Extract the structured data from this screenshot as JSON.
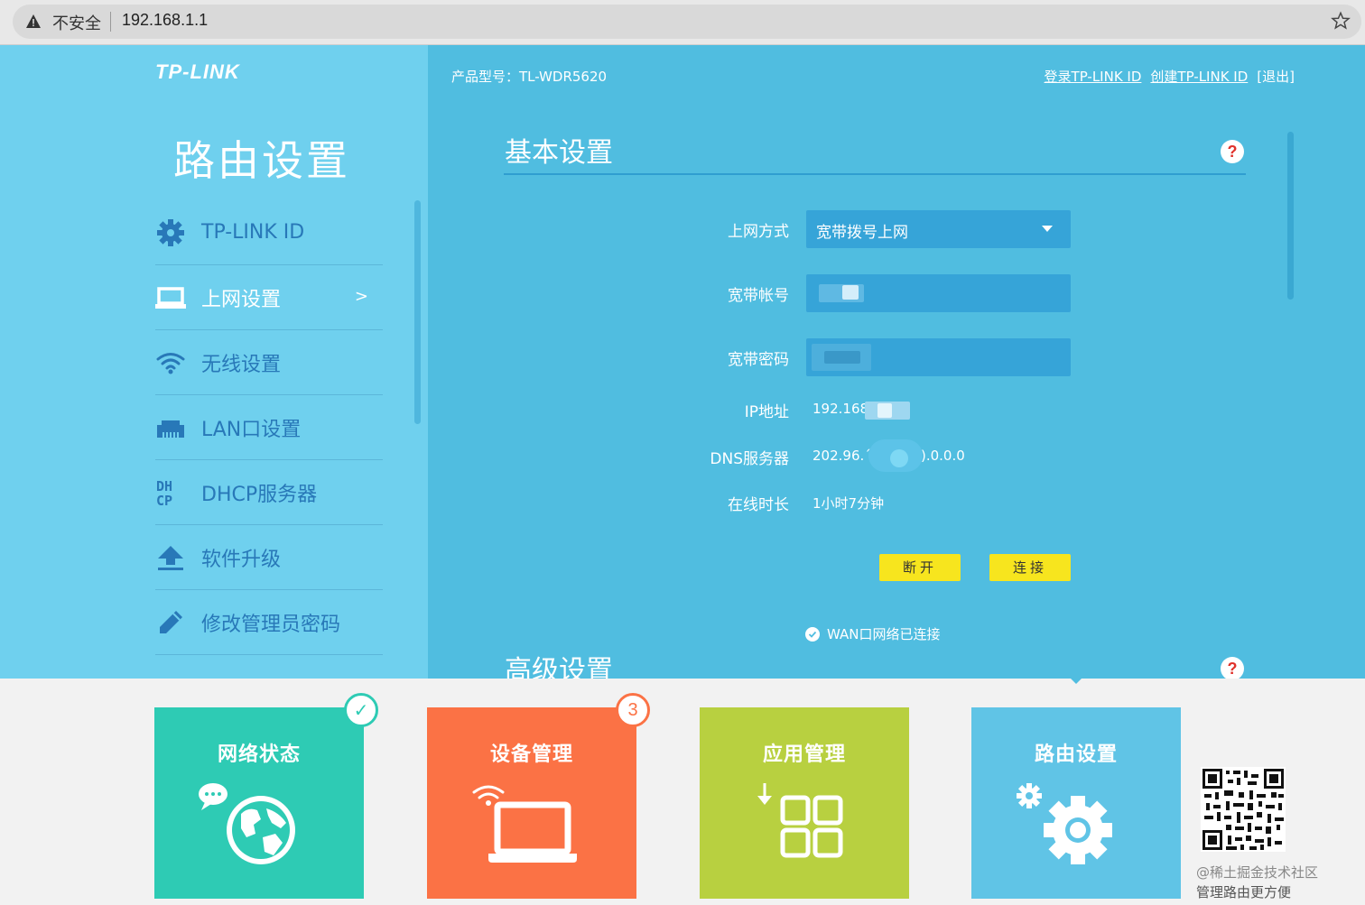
{
  "browser": {
    "security_label": "不安全",
    "url": "192.168.1.1"
  },
  "brand": {
    "logo_text": "TP-LINK"
  },
  "sidebar": {
    "title": "路由设置",
    "items": [
      {
        "label": "TP-LINK ID",
        "icon": "gear-icon",
        "active": false
      },
      {
        "label": "上网设置",
        "icon": "laptop-icon",
        "active": true,
        "arrow": ">"
      },
      {
        "label": "无线设置",
        "icon": "wifi-icon",
        "active": false
      },
      {
        "label": "LAN口设置",
        "icon": "lan-port-icon",
        "active": false
      },
      {
        "label": "DHCP服务器",
        "icon": "dhcp-icon",
        "active": false
      },
      {
        "label": "软件升级",
        "icon": "upload-icon",
        "active": false
      },
      {
        "label": "修改管理员密码",
        "icon": "pencil-icon",
        "active": false
      }
    ]
  },
  "header": {
    "product_model": "产品型号：TL-WDR5620",
    "login_link": "登录TP-LINK ID",
    "create_link": "创建TP-LINK ID",
    "logout_link": "[退出]"
  },
  "basic": {
    "title": "基本设置",
    "help": "?",
    "connection_type_label": "上网方式",
    "connection_type_value": "宽带拨号上网",
    "account_label": "宽带帐号",
    "password_label": "宽带密码",
    "ip_label": "IP地址",
    "ip_value": "192.168",
    "dns_label": "DNS服务器",
    "dns_value_left": "202.96.´",
    "dns_value_right": ").0.0.0",
    "uptime_label": "在线时长",
    "uptime_value": "1小时7分钟",
    "disconnect_button": "断开",
    "connect_button": "连接",
    "wan_status": "WAN口网络已连接"
  },
  "advanced": {
    "title": "高级设置",
    "help": "?"
  },
  "tiles": [
    {
      "label": "网络状态",
      "color": "#2ecbb4",
      "badge": "✓"
    },
    {
      "label": "设备管理",
      "color": "#fb7245",
      "badge": "3"
    },
    {
      "label": "应用管理",
      "color": "#b8d040",
      "badge": ""
    },
    {
      "label": "路由设置",
      "color": "#60c4e6",
      "badge": ""
    }
  ],
  "qr": {
    "watermark": "@稀土掘金技术社区",
    "caption": "管理路由更方便"
  },
  "colors": {
    "sidebar_bg": "#6fd0ee",
    "main_bg": "#50bde0",
    "button_yellow": "#f7e51e",
    "nav_text": "#2878b8"
  }
}
